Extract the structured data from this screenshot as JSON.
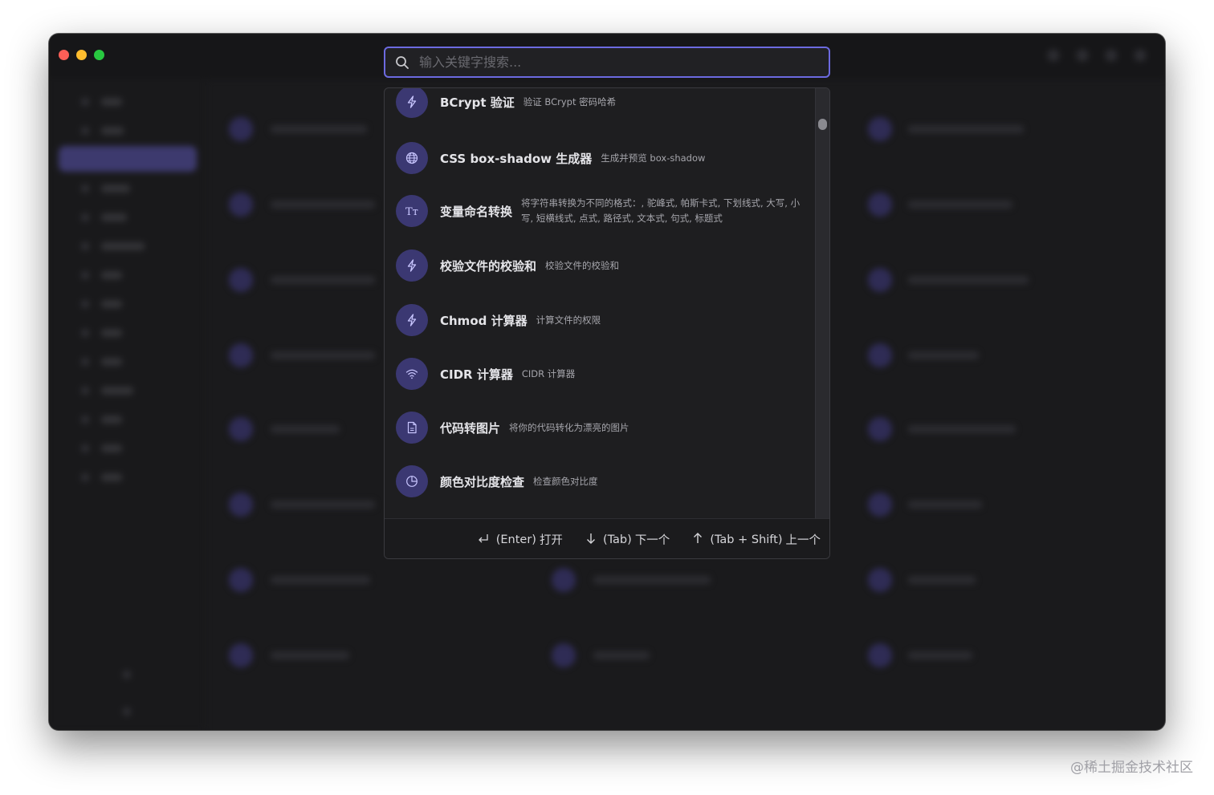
{
  "search": {
    "placeholder": "输入关键字搜索..."
  },
  "results": [
    {
      "icon": "bolt-icon",
      "title": "BCrypt 验证",
      "desc": "验证 BCrypt 密码哈希"
    },
    {
      "icon": "globe-icon",
      "title": "CSS box-shadow 生成器",
      "desc": "生成并预览 box-shadow"
    },
    {
      "icon": "text-case-icon",
      "title": "变量命名转换",
      "desc": "将字符串转换为不同的格式：, 驼峰式, 帕斯卡式, 下划线式, 大写, 小写, 短横线式, 点式, 路径式, 文本式, 句式, 标题式"
    },
    {
      "icon": "bolt-icon",
      "title": "校验文件的校验和",
      "desc": "校验文件的校验和"
    },
    {
      "icon": "bolt-icon",
      "title": "Chmod 计算器",
      "desc": "计算文件的权限"
    },
    {
      "icon": "wifi-icon",
      "title": "CIDR 计算器",
      "desc": "CIDR 计算器"
    },
    {
      "icon": "file-icon",
      "title": "代码转图片",
      "desc": "将你的代码转化为漂亮的图片"
    },
    {
      "icon": "contrast-icon",
      "title": "颜色对比度检查",
      "desc": "检查颜色对比度"
    }
  ],
  "footer": {
    "open_key": "(Enter)",
    "open_label": "打开",
    "next_key": "(Tab)",
    "next_label": "下一个",
    "prev_key": "(Tab + Shift)",
    "prev_label": "上一个"
  },
  "watermark": "@稀土掘金技术社区",
  "colors": {
    "accent": "#6c6ae0",
    "icon_bg": "#3b3872",
    "window_bg": "#1a1a1c"
  }
}
